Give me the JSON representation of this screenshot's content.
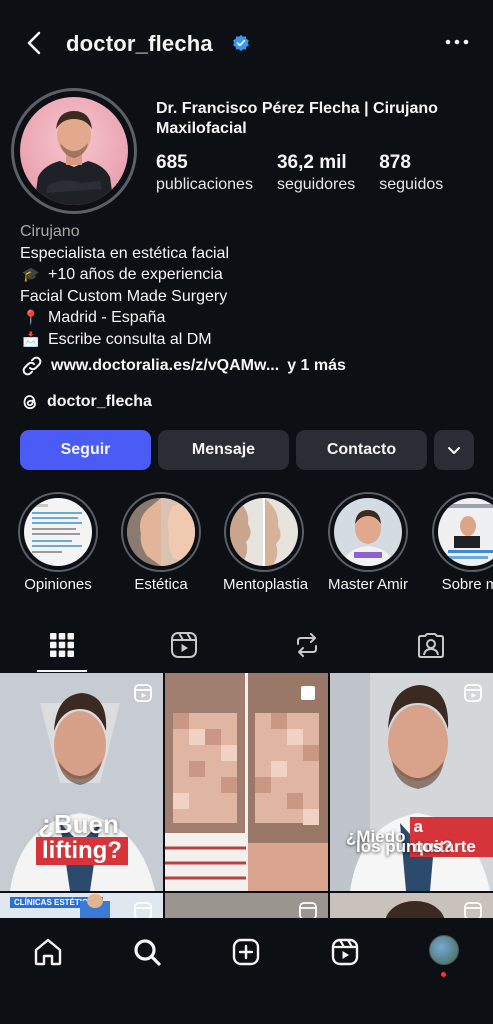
{
  "header": {
    "username": "doctor_flecha",
    "icons": [
      "back-icon",
      "verified-icon",
      "more-icon"
    ]
  },
  "profile": {
    "full_name": "Dr. Francisco Pérez Flecha | Cirujano Maxilofacial",
    "stats": [
      {
        "value": "685",
        "label": "publicaciones"
      },
      {
        "value": "36,2 mil",
        "label": "seguidores"
      },
      {
        "value": "878",
        "label": "seguidos"
      }
    ]
  },
  "bio": {
    "category": "Cirujano",
    "line1": "Especialista en estética facial",
    "line2": "+10 años de experiencia",
    "line3": "Facial Custom Made Surgery",
    "line4": "Madrid - España",
    "line5": "Escribe consulta al DM",
    "emoji2": "🎓",
    "emoji4": "📍",
    "emoji5": "📩",
    "link": "www.doctoralia.es/z/vQAMw...",
    "link_more": "y 1 más",
    "threads": "doctor_flecha"
  },
  "actions": {
    "follow": "Seguir",
    "message": "Mensaje",
    "contact": "Contacto"
  },
  "highlights": [
    {
      "label": "Opiniones"
    },
    {
      "label": "Estética"
    },
    {
      "label": "Mentoplastia"
    },
    {
      "label": "Master Amir"
    },
    {
      "label": "Sobre mí"
    }
  ],
  "posts": {
    "post1_line1": "¿Buen",
    "post1_line2": "lifting?",
    "post3_line1": "¿Miedo",
    "post3_line2": "a quitarte",
    "post3_line3": "los puntos?",
    "post4_banner": "CLÍNICAS ESTÉTICAS"
  },
  "colors": {
    "background": "#0c0f14",
    "primary_button": "#4a5cf5",
    "secondary_button": "#2a2d33",
    "verified": "#3897f0",
    "accent_red": "#d4343a"
  }
}
